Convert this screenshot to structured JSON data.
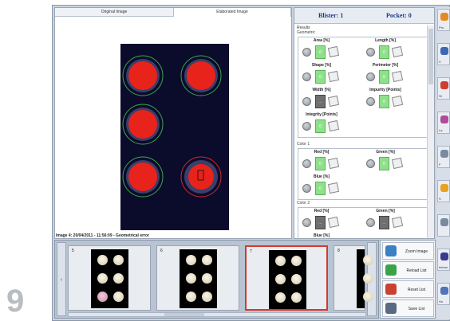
{
  "step_number": "9",
  "tabs": [
    {
      "label": "Original Image"
    },
    {
      "label": "Elaborated Image"
    }
  ],
  "status_line": "Image 4: 20/04/2011 - 11:56:09 - Geometrical error",
  "results": {
    "blister_label": "Blister: 1",
    "pocket_label": "Pocket: 0",
    "section_title": "Results",
    "groups": [
      {
        "title": "Geometric",
        "params": [
          {
            "label": "Area [%]",
            "value": "0",
            "state": "ok"
          },
          {
            "label": "Length [%]",
            "value": "0",
            "state": "ok"
          },
          {
            "label": "Shape [%]",
            "value": "0",
            "state": "ok"
          },
          {
            "label": "Perimeter [%]",
            "value": "0",
            "state": "ok"
          },
          {
            "label": "Width [%]",
            "value": "...",
            "state": "bad"
          },
          {
            "label": "Impurity [Points]",
            "value": "0",
            "state": "ok"
          },
          {
            "label": "Integrity [Points]",
            "value": "0",
            "state": "ok"
          }
        ]
      },
      {
        "title": "Color 1",
        "params": [
          {
            "label": "Red [%]",
            "value": "0",
            "state": "ok"
          },
          {
            "label": "Green [%]",
            "value": "0",
            "state": "ok"
          },
          {
            "label": "Blue [%]",
            "value": "0",
            "state": "ok"
          }
        ]
      },
      {
        "title": "Color 2",
        "params": [
          {
            "label": "Red [%]",
            "value": "...",
            "state": "bad"
          },
          {
            "label": "Green [%]",
            "value": "...",
            "state": "bad"
          },
          {
            "label": "Blue [%]",
            "value": "",
            "state": "ok"
          }
        ]
      }
    ]
  },
  "right_toolbar": [
    {
      "label": "Pro",
      "icon": "pencil-icon",
      "color": "#e58a1f"
    },
    {
      "label": "V",
      "icon": "chart-icon",
      "color": "#3b67b5"
    },
    {
      "label": "St",
      "icon": "pie-icon",
      "color": "#d23b2f"
    },
    {
      "label": "La",
      "icon": "brush-icon",
      "color": "#b04a9a"
    },
    {
      "label": "F",
      "icon": "refresh-icon",
      "color": "#7a8aa0"
    },
    {
      "label": "S",
      "icon": "warning-icon",
      "color": "#e8a21f"
    },
    {
      "label": "",
      "icon": "link-icon",
      "color": "#7a8aa0"
    },
    {
      "label": "Inform",
      "icon": "info-icon",
      "color": "#3a3a8c"
    },
    {
      "label": "Ho",
      "icon": "home-icon",
      "color": "#4f74b8"
    }
  ],
  "thumbnails": [
    {
      "number": "5",
      "selected": false,
      "pink": true
    },
    {
      "number": "6",
      "selected": false,
      "pink": false
    },
    {
      "number": "7",
      "selected": true,
      "pink": false
    },
    {
      "number": "8",
      "selected": false,
      "pink": false
    }
  ],
  "strip_nav": {
    "prev": "‹",
    "next": "›"
  },
  "actions": [
    {
      "label": "Zoom Image",
      "icon": "zoom-icon",
      "color": "#3b7fc4"
    },
    {
      "label": "Reload List",
      "icon": "reload-icon",
      "color": "#3aa34a"
    },
    {
      "label": "Reset List",
      "icon": "reset-icon",
      "color": "#c9422f"
    },
    {
      "label": "Save List",
      "icon": "save-icon",
      "color": "#5a6a80"
    }
  ]
}
